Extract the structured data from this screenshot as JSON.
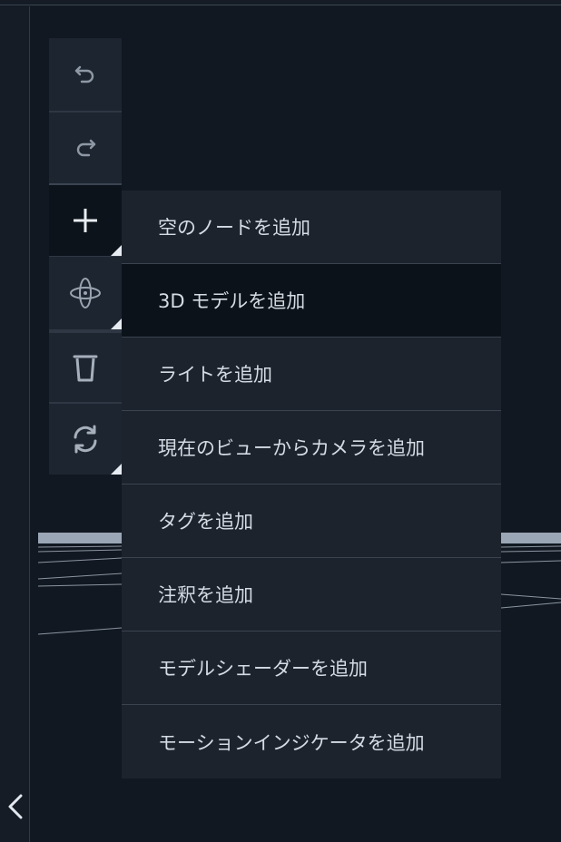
{
  "toolbar": {
    "buttons": [
      {
        "name": "undo",
        "icon": "undo-icon"
      },
      {
        "name": "redo",
        "icon": "redo-icon"
      },
      {
        "name": "add",
        "icon": "plus-icon",
        "active": true
      },
      {
        "name": "orbit",
        "icon": "orbit-icon"
      },
      {
        "name": "delete",
        "icon": "trash-icon"
      },
      {
        "name": "sync",
        "icon": "sync-icon"
      }
    ]
  },
  "add_menu": {
    "items": [
      {
        "label": "空のノードを追加"
      },
      {
        "label": "3D モデルを追加",
        "hover": true
      },
      {
        "label": "ライトを追加"
      },
      {
        "label": "現在のビューからカメラを追加"
      },
      {
        "label": "タグを追加"
      },
      {
        "label": "注釈を追加"
      },
      {
        "label": "モデルシェーダーを追加"
      },
      {
        "label": "モーションインジケータを追加"
      }
    ]
  },
  "sidebar": {
    "collapse_icon": "chevron-left-icon"
  },
  "colors": {
    "background": "#131a23",
    "toolbar_bg": "#1d2530",
    "toolbar_active_bg": "#0d131b",
    "menu_bg": "#1c232d",
    "menu_hover_bg": "#0c121a",
    "menu_text": "#d5dbe3",
    "icon": "#8e98a5"
  }
}
